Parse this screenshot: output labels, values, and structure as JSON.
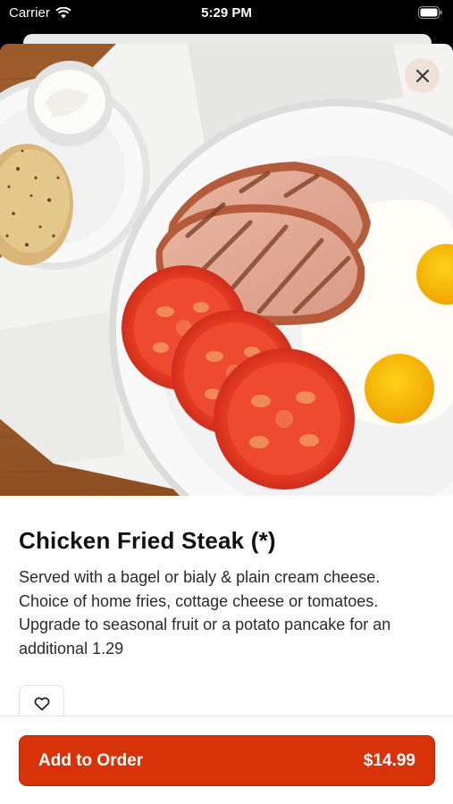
{
  "status_bar": {
    "carrier": "Carrier",
    "time": "5:29 PM"
  },
  "item": {
    "title": "Chicken Fried Steak (*)",
    "description": "Served with a bagel or bialy & plain cream cheese. Choice of home fries, cottage cheese or tomatoes. Upgrade to seasonal fruit or a potato pancake for an additional 1.29",
    "image_icon": "food-photo"
  },
  "actions": {
    "close_icon": "close-icon",
    "favorite_icon": "heart-icon",
    "add_label": "Add to Order",
    "price": "$14.99"
  },
  "colors": {
    "accent": "#d83208",
    "close_bg": "#eee1d7"
  }
}
